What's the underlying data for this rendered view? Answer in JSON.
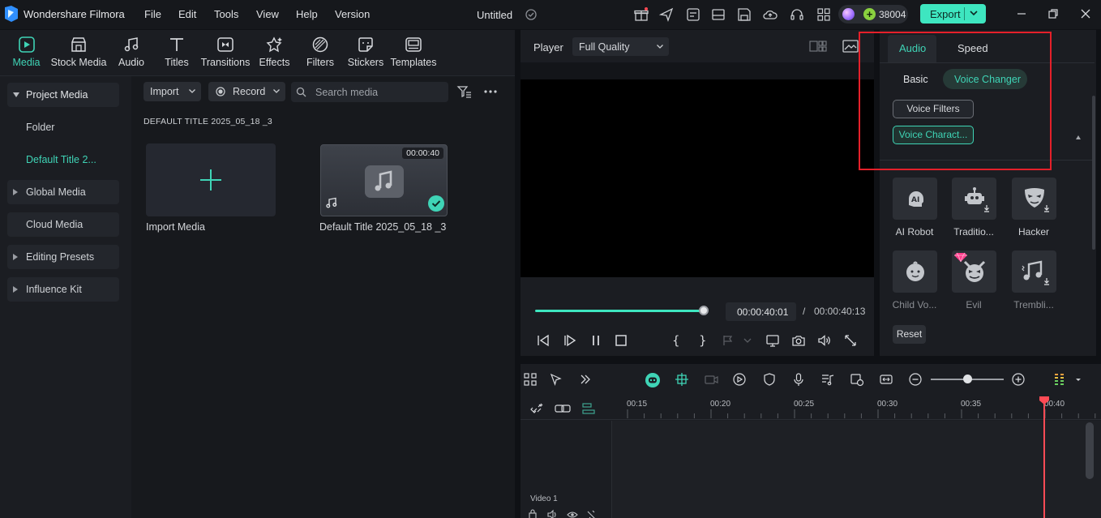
{
  "app": {
    "name": "Wondershare Filmora",
    "menu": [
      "File",
      "Edit",
      "Tools",
      "View",
      "Help",
      "Version"
    ],
    "document_title": "Untitled",
    "credits": "38004",
    "export_label": "Export"
  },
  "toolbar_tabs": [
    {
      "label": "Media",
      "icon": "media-icon",
      "active": true
    },
    {
      "label": "Stock Media",
      "icon": "stock-media-icon"
    },
    {
      "label": "Audio",
      "icon": "music-note-icon"
    },
    {
      "label": "Titles",
      "icon": "titles-icon"
    },
    {
      "label": "Transitions",
      "icon": "transitions-icon"
    },
    {
      "label": "Effects",
      "icon": "effects-icon"
    },
    {
      "label": "Filters",
      "icon": "filters-icon"
    },
    {
      "label": "Stickers",
      "icon": "stickers-icon"
    },
    {
      "label": "Templates",
      "icon": "templates-icon"
    }
  ],
  "sidebar": {
    "items": [
      {
        "label": "Project Media"
      },
      {
        "label": "Folder"
      },
      {
        "label": "Default Title 2..."
      },
      {
        "label": "Global Media"
      },
      {
        "label": "Cloud Media"
      },
      {
        "label": "Editing Presets"
      },
      {
        "label": "Influence Kit"
      }
    ]
  },
  "media": {
    "import_label": "Import",
    "record_label": "Record",
    "search_placeholder": "Search media",
    "heading": "DEFAULT TITLE 2025_05_18 _3",
    "items": [
      {
        "caption": "Import Media"
      },
      {
        "caption": "Default Title 2025_05_18 _3",
        "duration": "00:00:40"
      }
    ]
  },
  "player": {
    "label": "Player",
    "quality": "Full Quality",
    "current_time": "00:00:40:01",
    "separator": "/",
    "total_time": "00:00:40:13",
    "progress": 1.0
  },
  "properties": {
    "tabs": [
      "Audio",
      "Speed"
    ],
    "subtabs": [
      "Basic",
      "Voice Changer"
    ],
    "chips": [
      "Voice Filters",
      "Voice Charact..."
    ],
    "voices": [
      {
        "label": "AI Robot",
        "icon": "ai-head-icon"
      },
      {
        "label": "Traditio...",
        "icon": "robot-icon"
      },
      {
        "label": "Hacker",
        "icon": "mask-icon"
      },
      {
        "label": "Child Vo...",
        "icon": "baby-face-icon"
      },
      {
        "label": "Evil",
        "icon": "devil-face-icon"
      },
      {
        "label": "Trembli...",
        "icon": "music-notes-icon"
      }
    ],
    "reset_label": "Reset"
  },
  "timeline": {
    "ruler_labels": [
      "00:15",
      "00:20",
      "00:25",
      "00:30",
      "00:35",
      "00:40"
    ],
    "track_name": "Video 1"
  },
  "colors": {
    "accent": "#3fd4b6",
    "export": "#3ee6c0",
    "highlight": "#e5202a",
    "playhead": "#ff4b55"
  }
}
